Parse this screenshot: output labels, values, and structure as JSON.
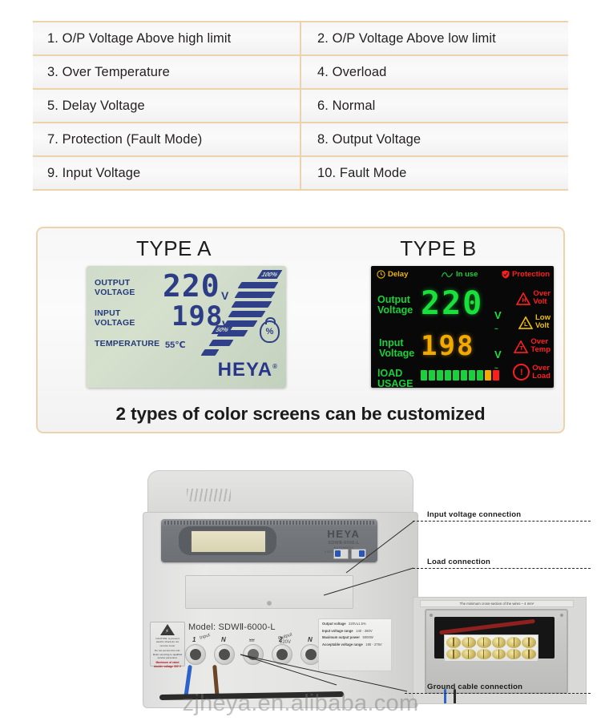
{
  "legend": {
    "rows": [
      [
        "1. O/P Voltage Above high limit",
        "2. O/P Voltage Above low limit"
      ],
      [
        "3. Over Temperature",
        "4. Overload"
      ],
      [
        "5. Delay Voltage",
        " 6. Normal"
      ],
      [
        "7. Protection (Fault Mode)",
        "8. Output Voltage"
      ],
      [
        "9. Input Voltage",
        "10. Fault Mode"
      ]
    ]
  },
  "screens": {
    "type_a_title": "TYPE A",
    "type_b_title": "TYPE B",
    "caption": "2 types of color screens can be customized",
    "type_a": {
      "output_label": "OUTPUT\nVOLTAGE",
      "output_label_l1": "OUTPUT",
      "output_label_l2": "VOLTAGE",
      "input_label_l1": "INPUT",
      "input_label_l2": "VOLTAGE",
      "temperature_label": "TEMPERATURE",
      "output_value": "220",
      "output_unit": "V",
      "input_value": "198",
      "input_unit": "V",
      "temperature_value": "55℃",
      "bar_top_pct": "100%",
      "bar_mid_pct": "50%",
      "load_icon_text": "%",
      "brand": "HEYA",
      "brand_mark": "®"
    },
    "type_b": {
      "delay_label": "Delay",
      "inuse_label": "In use",
      "protection_label": "Protection",
      "output_label_l1": "Output",
      "output_label_l2": "Voltage",
      "input_label_l1": "Input",
      "input_label_l2": "Voltage",
      "load_label_l1": "lOAD",
      "load_label_l2": "USAGE",
      "output_value": "220",
      "output_unit": "V",
      "input_value": "198",
      "input_unit": "V",
      "warnings": [
        {
          "code": "H",
          "line1": "Over",
          "line2": "Volt",
          "color": "#ff1e1e"
        },
        {
          "code": "L",
          "line1": "Low",
          "line2": "Volt",
          "color": "#f0c000"
        },
        {
          "code": "T",
          "line1": "Over",
          "line2": "Temp",
          "color": "#ff1e1e"
        },
        {
          "code": "!",
          "line1": "Over",
          "line2": "Load",
          "color": "#ff1e1e"
        }
      ],
      "load_bars": [
        "#19d13a",
        "#19d13a",
        "#19d13a",
        "#19d13a",
        "#19d13a",
        "#19d13a",
        "#19d13a",
        "#19d13a",
        "#f2a900",
        "#ff1e1e"
      ]
    }
  },
  "product": {
    "panel_brand": "HEYA",
    "panel_model": "SDWⅡ-6000-L",
    "panel_sub1": "AUTOMATIC",
    "panel_sub2": "VOLTAGE REGULATOR",
    "model_text": "Model: SDWⅡ-6000-L",
    "input_tag": "Input",
    "output_tag": "Output",
    "output_voltage_tag": "220V",
    "terminals": [
      "1",
      "N",
      "⏚",
      "2",
      "N"
    ],
    "spec": [
      {
        "name": "Output voltage",
        "value": "220V±1.5%"
      },
      {
        "name": "Input voltage range",
        "value": "140 - 260V"
      },
      {
        "name": "Maximum output power",
        "value": "5000W"
      },
      {
        "name": "Acceptable voltage range",
        "value": "180 - 275V"
      }
    ],
    "warning_sticker": {
      "line1": "CAUTION: to prevent electric",
      "line2": "shock,do not remove cover",
      "line3": "Do not service this unit.",
      "line4": "Refer servicing to qualified",
      "line5": "service personnel.",
      "line6": "Maximum of rated double",
      "line7": "voltage 300 V"
    },
    "callouts": [
      "Input voltage connection",
      "Load connection",
      "Ground cable connection"
    ],
    "inset_note": "The minimum cross-section of the wires – 4 mm²"
  },
  "watermark": "zjheya.en.alibaba.com",
  "colors": {
    "table_border": "#edd3ac",
    "panel_border": "#edd3ac",
    "lcd_a_text": "#2c3d86",
    "led_green": "#19d13a",
    "led_amber": "#f2a900",
    "led_red": "#ff1e1e"
  }
}
